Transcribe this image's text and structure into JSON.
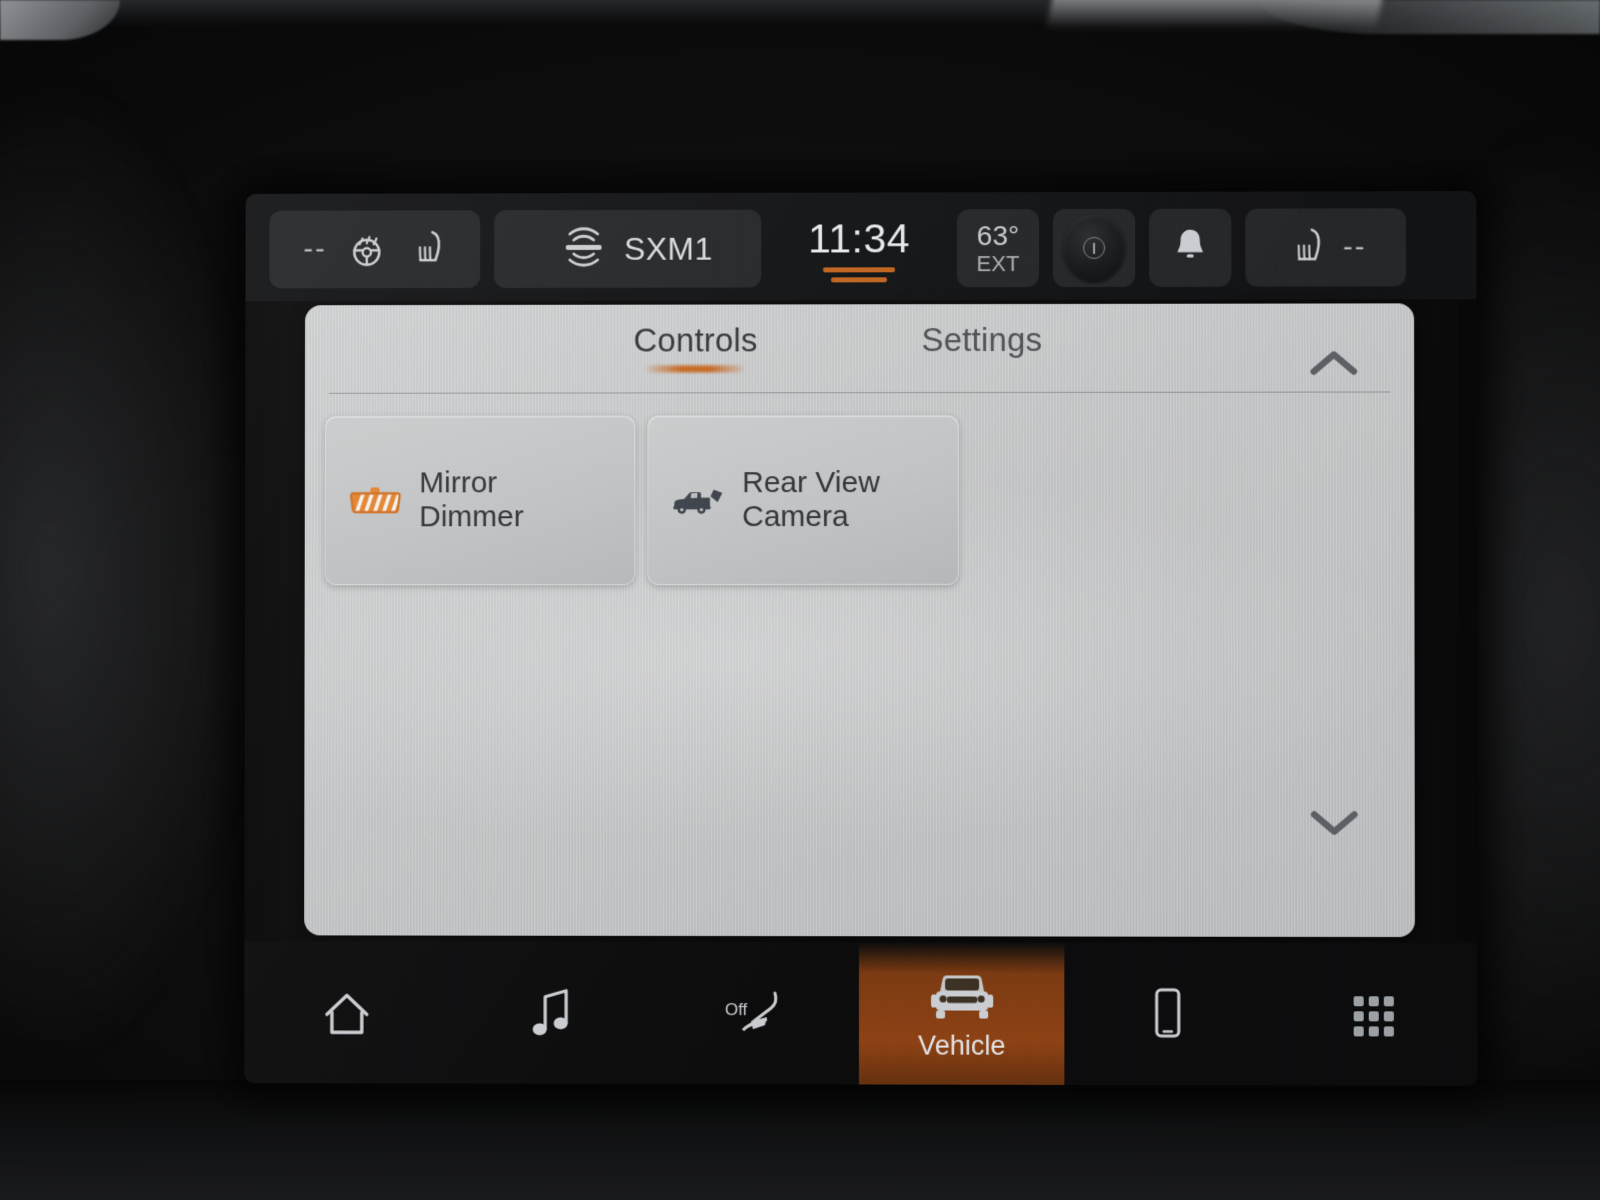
{
  "device": {
    "type": "vehicle-infotainment-touchscreen"
  },
  "status_bar": {
    "media": {
      "source_label": "SXM1",
      "logo": "siriusxm-logo",
      "placeholder_dashes": "--"
    },
    "vehicle_left": {
      "dashes": "--",
      "icons": [
        "heated-steering-wheel-icon",
        "heated-seat-left-icon"
      ]
    },
    "clock": {
      "time": "11:34",
      "bars": 2
    },
    "temperature": {
      "value": "63°",
      "label": "EXT"
    },
    "knob": {
      "icon": "volume-knob-icon"
    },
    "notifications": {
      "icon": "bell-icon"
    },
    "vehicle_right": {
      "icon": "heated-seat-right-icon",
      "value": "--"
    }
  },
  "panel": {
    "tabs": [
      {
        "label": "Controls",
        "active": true
      },
      {
        "label": "Settings",
        "active": false
      }
    ],
    "tiles": [
      {
        "label_line1": "Mirror",
        "label_line2": "Dimmer",
        "icon": "mirror-dimmer-icon",
        "icon_state": "on"
      },
      {
        "label_line1": "Rear View",
        "label_line2": "Camera",
        "icon": "rear-view-camera-icon",
        "icon_state": "off"
      }
    ],
    "scroll": {
      "up": "chevron-up-icon",
      "down": "chevron-down-icon"
    }
  },
  "nav_bar": {
    "items": [
      {
        "label": "",
        "icon": "home-icon",
        "active": false
      },
      {
        "label": "",
        "icon": "media-music-icon",
        "active": false
      },
      {
        "label": "",
        "icon": "climate-off-icon",
        "status_text": "Off",
        "active": false
      },
      {
        "label": "Vehicle",
        "icon": "vehicle-truck-icon",
        "active": true
      },
      {
        "label": "",
        "icon": "phone-icon",
        "active": false
      },
      {
        "label": "",
        "icon": "apps-grid-icon",
        "active": false
      }
    ]
  },
  "colors": {
    "accent_orange": "#c4651e",
    "nav_active": "#8c4114",
    "panel_bg": "#c3c5c6",
    "status_bg": "#121315",
    "text_dark": "#2e3136",
    "text_light": "#c9ccd0"
  }
}
